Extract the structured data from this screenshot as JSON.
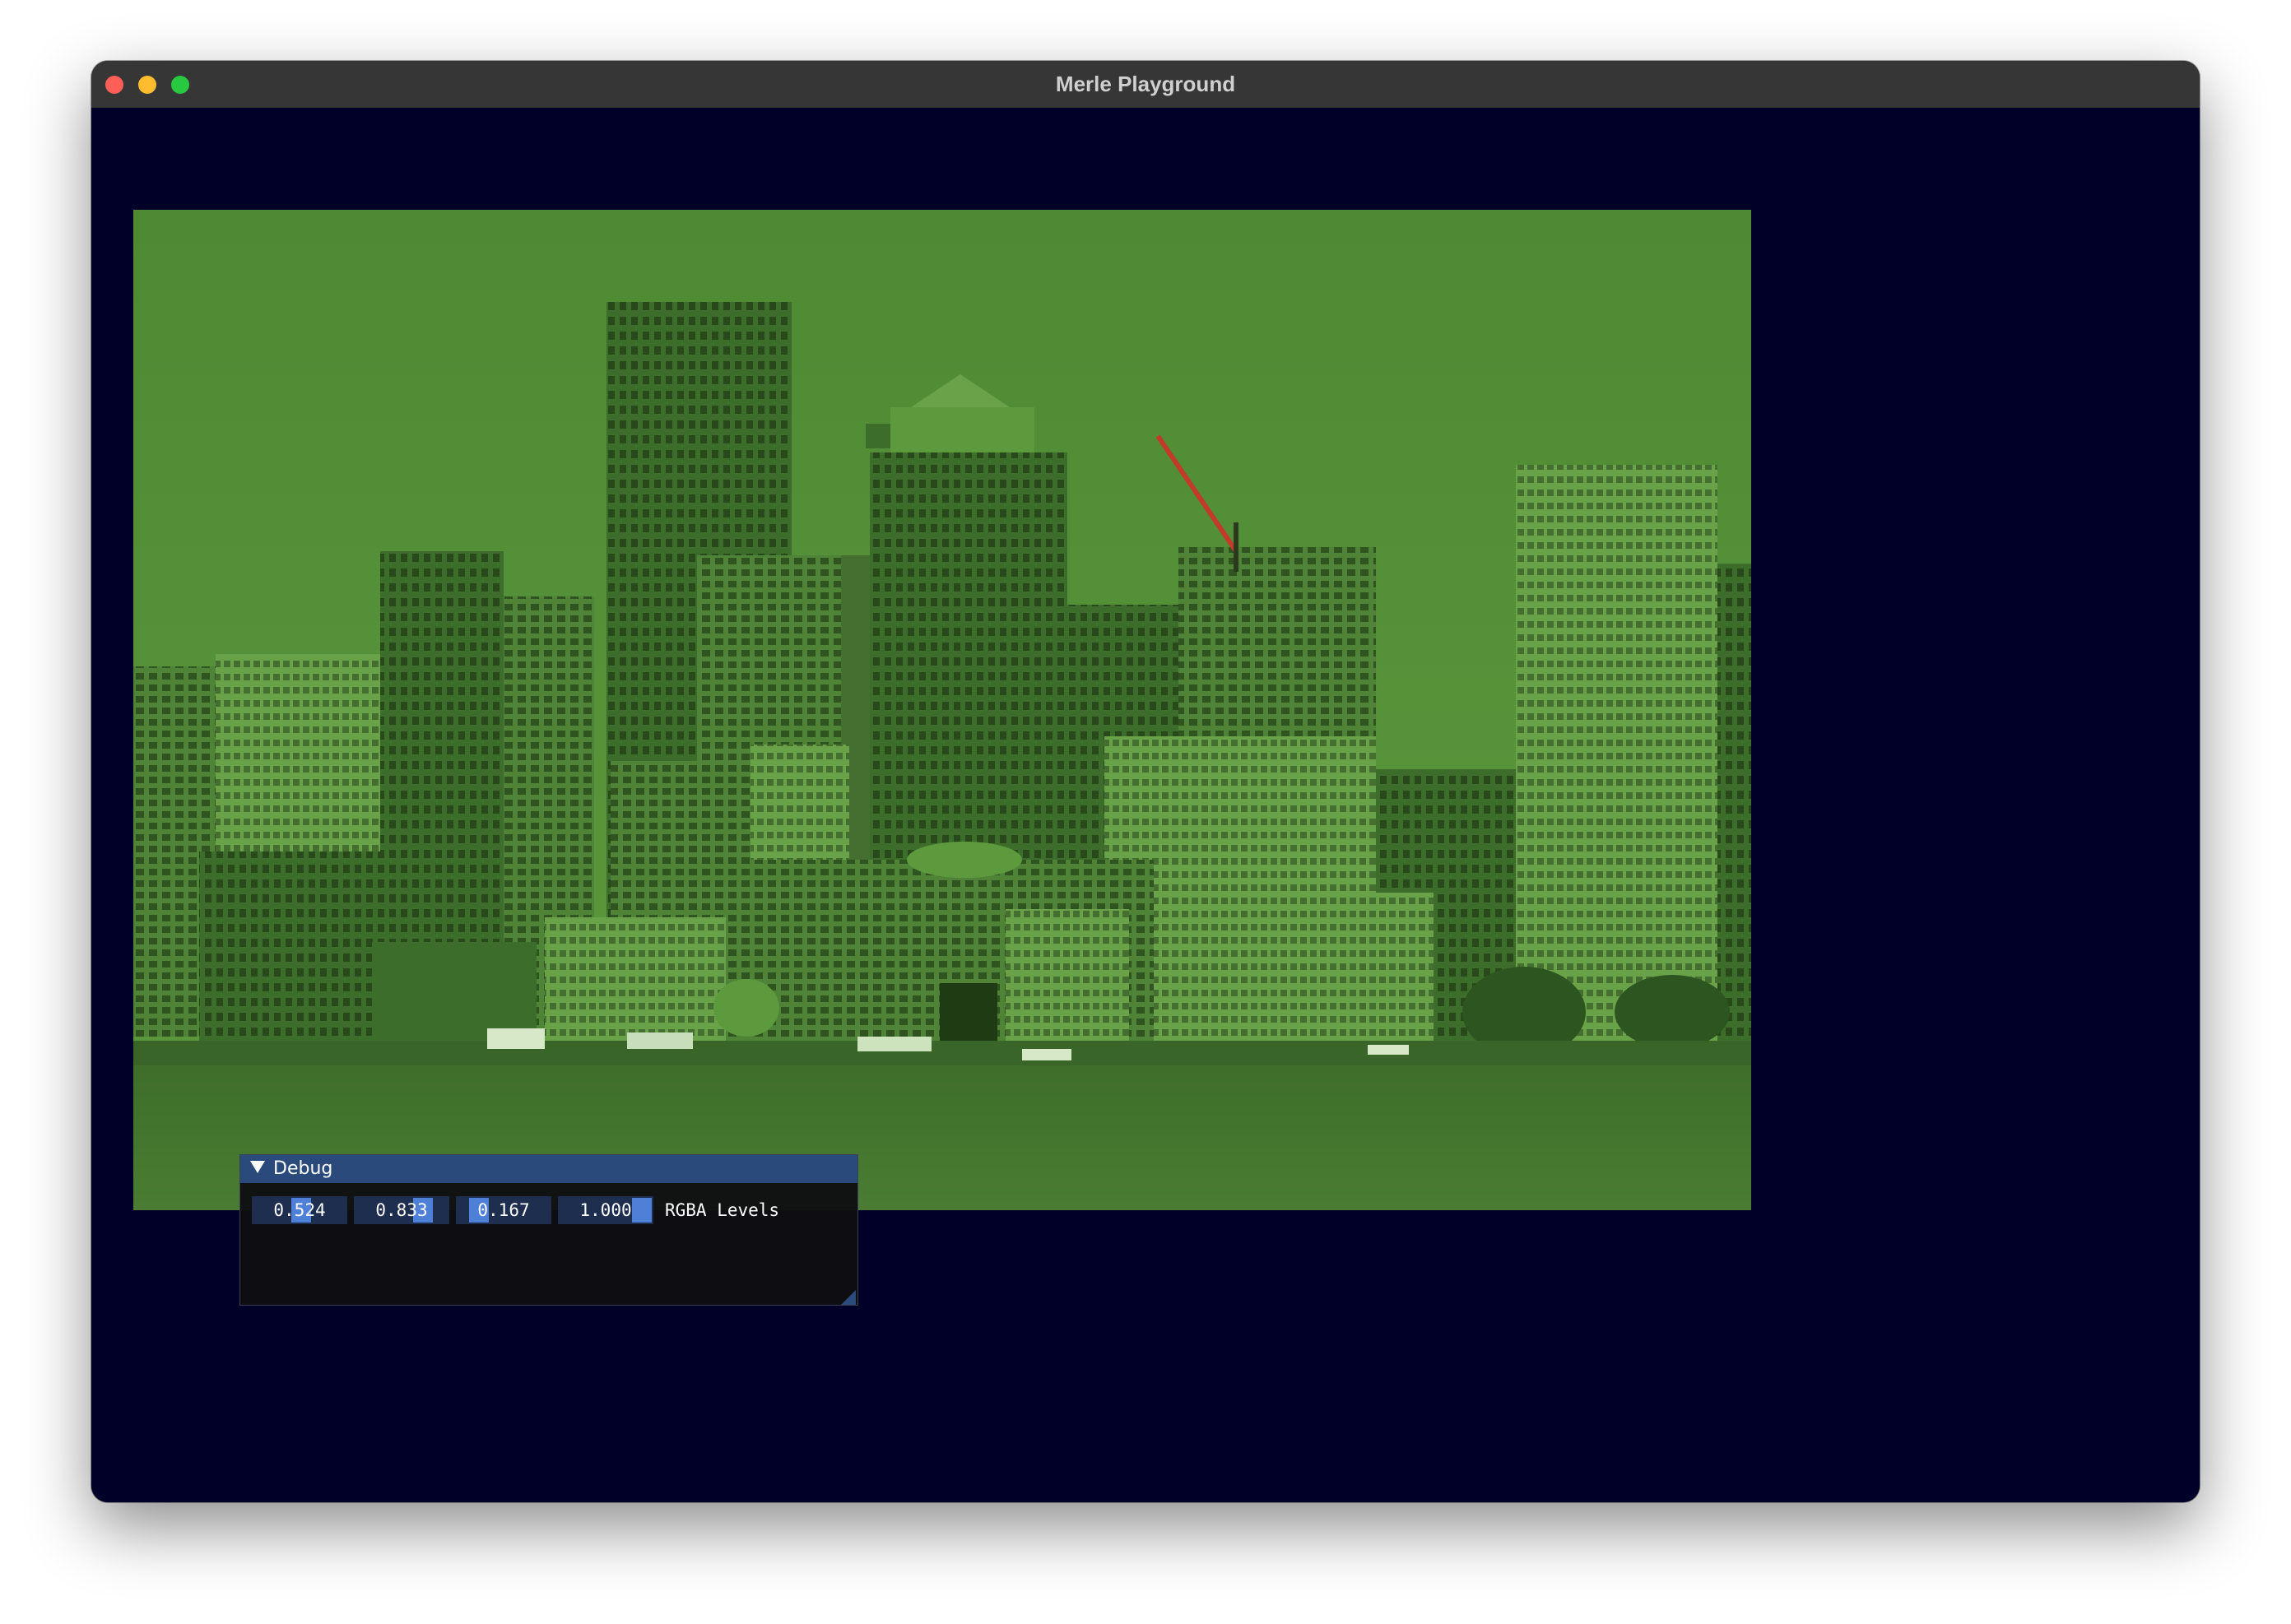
{
  "window": {
    "title": "Merle Playground"
  },
  "image": {
    "subject": "city skyline on waterfront",
    "tint": "#4c8a33"
  },
  "debug": {
    "title": "Debug",
    "collapse_icon": "triangle-down-icon",
    "levels": {
      "r": "0.524",
      "g": "0.833",
      "b": "0.167",
      "a": "1.000",
      "label": "RGBA Levels"
    }
  },
  "colors": {
    "background": "#000029",
    "titlebar": "#363636",
    "panel_header": "#294a7a",
    "field": "#1d2e4f",
    "slider_grab": "#4f80d8"
  }
}
